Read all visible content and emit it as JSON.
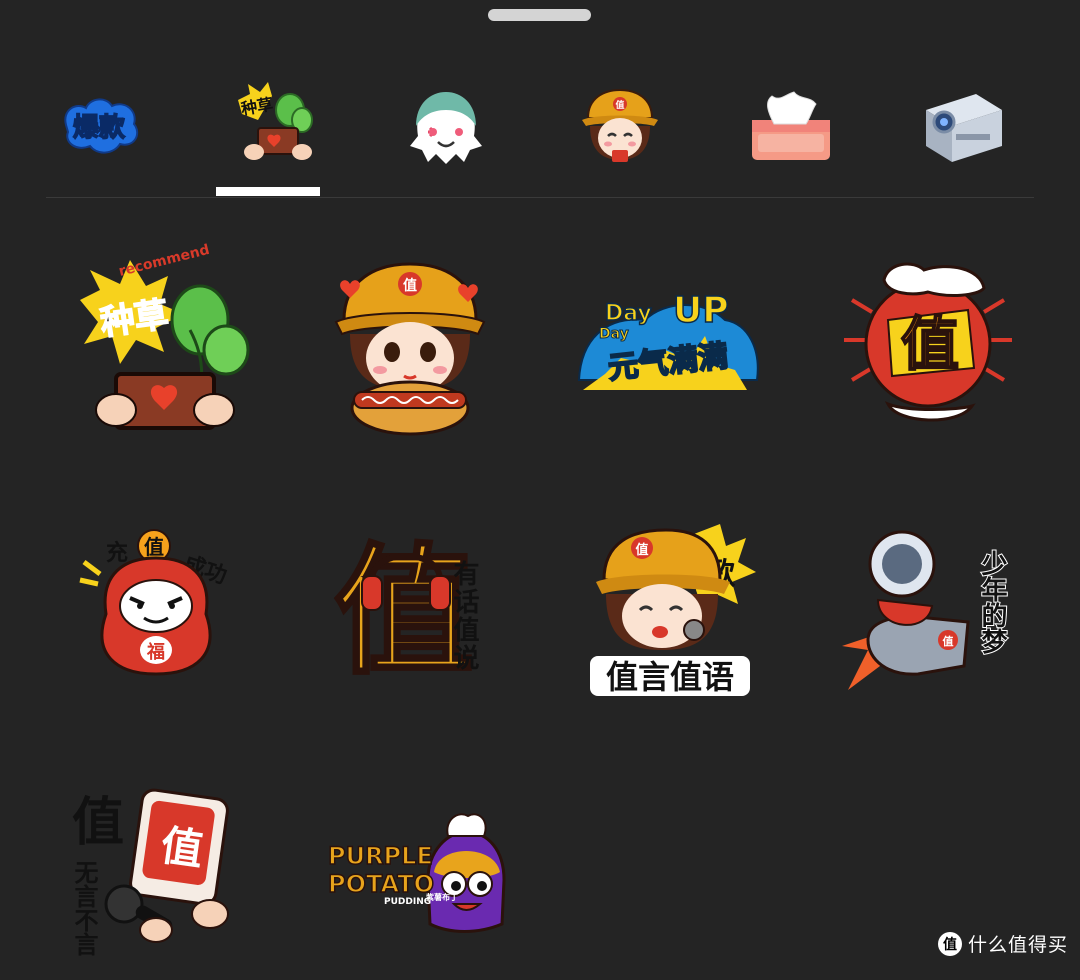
{
  "tabs": [
    {
      "id": "hot",
      "label": "爆款",
      "icon": "hot-label-icon"
    },
    {
      "id": "recommend",
      "label": "种草",
      "icon": "plant-pot-icon"
    },
    {
      "id": "ghost",
      "label": "",
      "icon": "ghost-icon"
    },
    {
      "id": "girl",
      "label": "值",
      "icon": "girl-cap-icon"
    },
    {
      "id": "tissue",
      "label": "",
      "icon": "tissue-box-icon"
    },
    {
      "id": "camera",
      "label": "",
      "icon": "polaroid-camera-icon"
    }
  ],
  "selected_tab": "recommend",
  "stickers": [
    {
      "name": "sticker-plant-recommend",
      "texts": [
        "recommend",
        "种草"
      ]
    },
    {
      "name": "sticker-girl-hotdog",
      "texts": [
        "值"
      ]
    },
    {
      "name": "sticker-dayup",
      "texts": [
        "Day",
        "UP",
        "Day",
        "元气满满"
      ]
    },
    {
      "name": "sticker-zhi-hand",
      "texts": [
        "值"
      ]
    },
    {
      "name": "sticker-daruma",
      "texts": [
        "充",
        "值",
        "成功",
        "福"
      ]
    },
    {
      "name": "sticker-zhi-headphone",
      "texts": [
        "值",
        "有话值说"
      ]
    },
    {
      "name": "sticker-girl-sing",
      "texts": [
        "值",
        "歌",
        "值言值语"
      ]
    },
    {
      "name": "sticker-astronaut",
      "texts": [
        "少年的梦",
        "值"
      ]
    },
    {
      "name": "sticker-mahjong-mic",
      "texts": [
        "值",
        "无言不言",
        "值"
      ]
    },
    {
      "name": "sticker-purple-potato",
      "texts": [
        "PURPLE",
        "POTATO",
        "PUDDING",
        "紫薯布丁"
      ]
    }
  ],
  "watermark": {
    "logo": "值",
    "text": "什么值得买"
  },
  "colors": {
    "background": "#242424",
    "accent": "#ffffff"
  }
}
